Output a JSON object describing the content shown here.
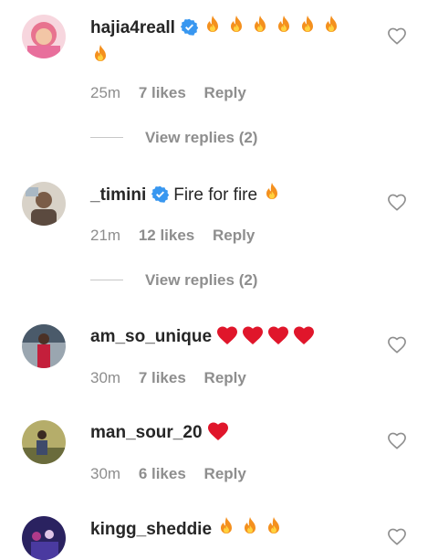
{
  "comments": [
    {
      "username": "hajia4reall",
      "verified": true,
      "text": "",
      "emojis": [
        "fire",
        "fire",
        "fire",
        "fire",
        "fire",
        "fire",
        "fire"
      ],
      "time": "25m",
      "likes": "7 likes",
      "reply": "Reply",
      "view_replies": "View replies (2)",
      "avatar_colors": [
        "#f4b3c6",
        "#e8738f"
      ]
    },
    {
      "username": "_timini",
      "verified": true,
      "text": "Fire for fire",
      "emojis": [
        "fire"
      ],
      "time": "21m",
      "likes": "12 likes",
      "reply": "Reply",
      "view_replies": "View replies (2)",
      "avatar_colors": [
        "#c9c3bb",
        "#6b5d52"
      ]
    },
    {
      "username": "am_so_unique",
      "verified": false,
      "text": "",
      "emojis": [
        "heart",
        "heart",
        "heart",
        "heart"
      ],
      "time": "30m",
      "likes": "7 likes",
      "reply": "Reply",
      "avatar_colors": [
        "#2d3b4c",
        "#c41f3b"
      ]
    },
    {
      "username": "man_sour_20",
      "verified": false,
      "text": "",
      "emojis": [
        "heart"
      ],
      "time": "30m",
      "likes": "6 likes",
      "reply": "Reply",
      "avatar_colors": [
        "#8a8f4a",
        "#3e4a6b"
      ]
    },
    {
      "username": "kingg_sheddie",
      "verified": false,
      "text": "",
      "emojis": [
        "fire",
        "fire",
        "fire"
      ],
      "avatar_colors": [
        "#3a2f7a",
        "#b03a8a"
      ]
    }
  ],
  "colors": {
    "verified": "#3897f0",
    "muted": "#8e8e8e",
    "heart_emoji": "#e0162b",
    "fire_outer": "#f4901e",
    "fire_inner": "#ffd23f"
  }
}
